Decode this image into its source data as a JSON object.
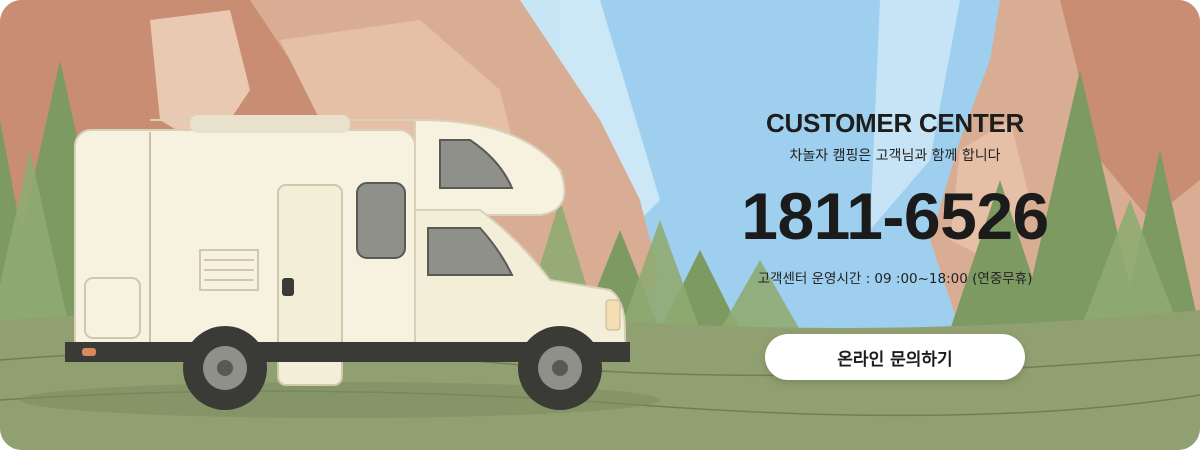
{
  "colors": {
    "sky": "#8ec6ec",
    "rock": "#d9ad93",
    "forest": "#6f8a56",
    "ground": "#91a070",
    "rv_body": "#f7f2df",
    "button_bg": "#ffffff"
  },
  "icons": {
    "rv_illustration": "camper-van-icon"
  },
  "customer_center": {
    "title": "CUSTOMER CENTER",
    "subtitle": "차놀자 캠핑은 고객님과 함께 합니다",
    "phone": "1811-6526",
    "hours": "고객센터 운영시간 :  09 :00~18:00 (연중무휴)"
  },
  "inquiry_button": {
    "label": "온라인 문의하기"
  }
}
